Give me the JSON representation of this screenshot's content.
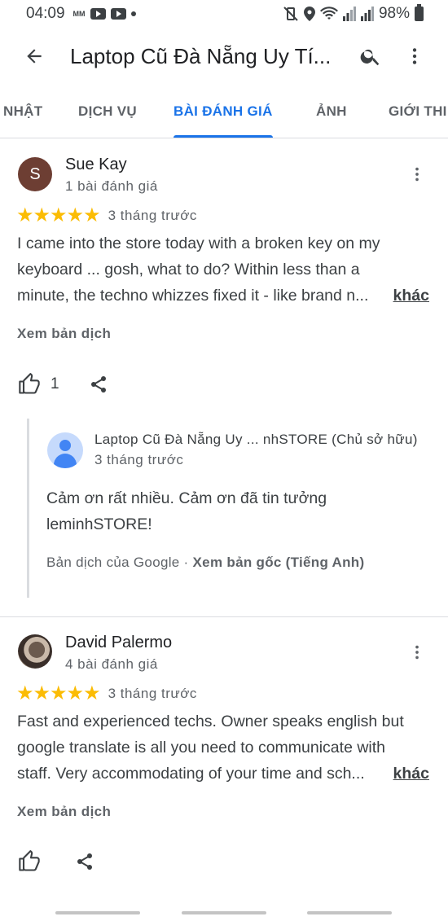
{
  "status_bar": {
    "time": "04:09",
    "small_label": "MM",
    "battery": "98%"
  },
  "app_bar": {
    "title": "Laptop Cũ Đà Nẵng Uy Tí..."
  },
  "tabs": [
    {
      "label": "NHẬT",
      "active": false
    },
    {
      "label": "DỊCH VỤ",
      "active": false
    },
    {
      "label": "BÀI ĐÁNH GIÁ",
      "active": true
    },
    {
      "label": "ẢNH",
      "active": false
    },
    {
      "label": "GIỚI THI",
      "active": false
    }
  ],
  "colors": {
    "accent": "#1a73e8",
    "star": "#fbbc04",
    "avatar_s": "#6d3e33"
  },
  "reviews": [
    {
      "avatar_letter": "S",
      "name": "Sue Kay",
      "meta": "1 bài đánh giá",
      "rating": 5,
      "stars": "★★★★★",
      "date": "3 tháng trước",
      "lines": [
        "I came into the store today with a broken key on my",
        "keyboard ... gosh, what to do?  Within less than a",
        "minute, the techno whizzes fixed it - like brand n..."
      ],
      "more": "khác",
      "translate": "Xem bản dịch",
      "likes": "1",
      "reply": {
        "name": "Laptop Cũ Đà Nẵng Uy ...  nhSTORE (Chủ sở hữu)",
        "date": "3 tháng trước",
        "lines": [
          "Cảm ơn rất nhiều. Cảm ơn đã tin tưởng",
          "leminhSTORE!"
        ],
        "translated_by": "Bản dịch của Google · ",
        "see_original": "Xem bản gốc (Tiếng Anh)"
      }
    },
    {
      "name": "David Palermo",
      "meta": "4 bài đánh giá",
      "rating": 5,
      "stars": "★★★★★",
      "date": "3 tháng trước",
      "lines": [
        "Fast and experienced techs. Owner speaks english but",
        "google translate is all you need to communicate with",
        "staff. Very accommodating of your time and sch..."
      ],
      "more": "khác",
      "translate": "Xem bản dịch"
    }
  ]
}
